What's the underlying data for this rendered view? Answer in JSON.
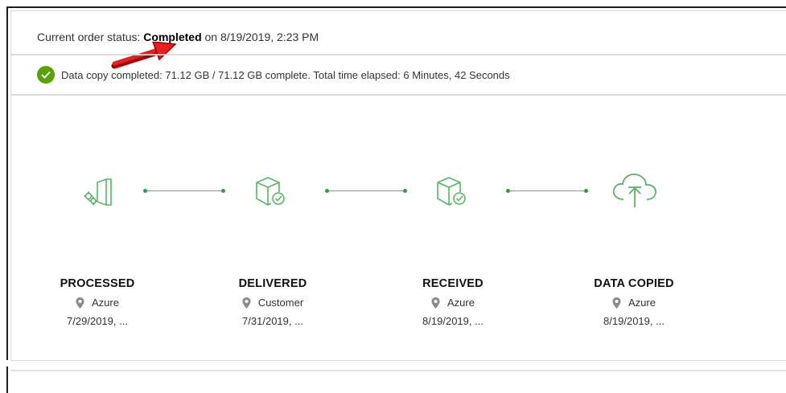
{
  "status": {
    "prefix": "Current order status: ",
    "state": "Completed",
    "suffix": " on 8/19/2019, 2:23 PM"
  },
  "copy_message": "Data copy completed: 71.12 GB / 71.12 GB complete. Total time elapsed: 6 Minutes, 42 Seconds",
  "accent_color": "#57a300",
  "steps": [
    {
      "title": "PROCESSED",
      "location": "Azure",
      "date": "7/29/2019, ...",
      "icon": "server-gears-icon"
    },
    {
      "title": "DELIVERED",
      "location": "Customer",
      "date": "7/31/2019, ...",
      "icon": "box-check-icon"
    },
    {
      "title": "RECEIVED",
      "location": "Azure",
      "date": "8/19/2019, ...",
      "icon": "box-check-icon"
    },
    {
      "title": "DATA COPIED",
      "location": "Azure",
      "date": "8/19/2019, ...",
      "icon": "cloud-upload-icon"
    }
  ]
}
